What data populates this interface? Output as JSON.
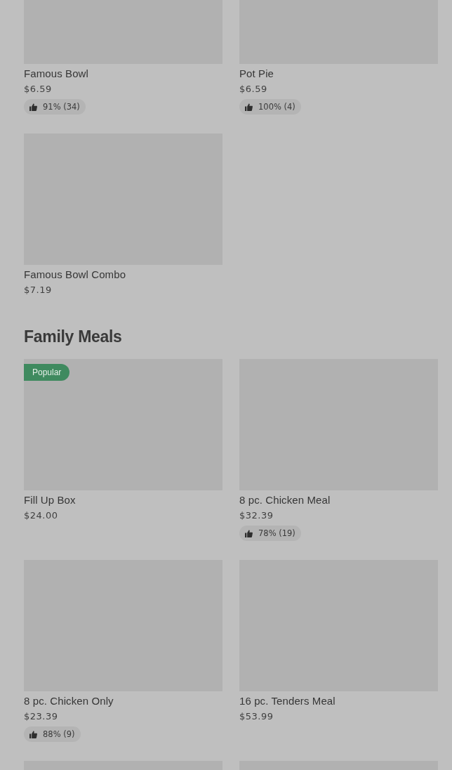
{
  "sections": [
    {
      "items": [
        {
          "kind": "item",
          "name": "Famous Bowl",
          "price": "$6.59",
          "rating": "91% (34)"
        },
        {
          "kind": "item",
          "name": "Pot Pie",
          "price": "$6.59",
          "rating": "100% (4)"
        },
        {
          "kind": "item",
          "name": "Famous Bowl Combo",
          "price": "$7.19"
        }
      ]
    },
    {
      "title": "Family Meals",
      "items": [
        {
          "kind": "item",
          "name": "Fill Up Box",
          "price": "$24.00",
          "badge": "Popular"
        },
        {
          "kind": "item",
          "name": "8 pc. Chicken Meal",
          "price": "$32.39",
          "rating": "78% (19)"
        },
        {
          "kind": "item",
          "name": "8 pc. Chicken Only",
          "price": "$23.39",
          "rating": "88% (9)"
        },
        {
          "kind": "item",
          "name": "16 pc. Tenders Meal",
          "price": "$53.99"
        },
        {
          "kind": "image_only"
        },
        {
          "kind": "image_only"
        }
      ]
    }
  ]
}
